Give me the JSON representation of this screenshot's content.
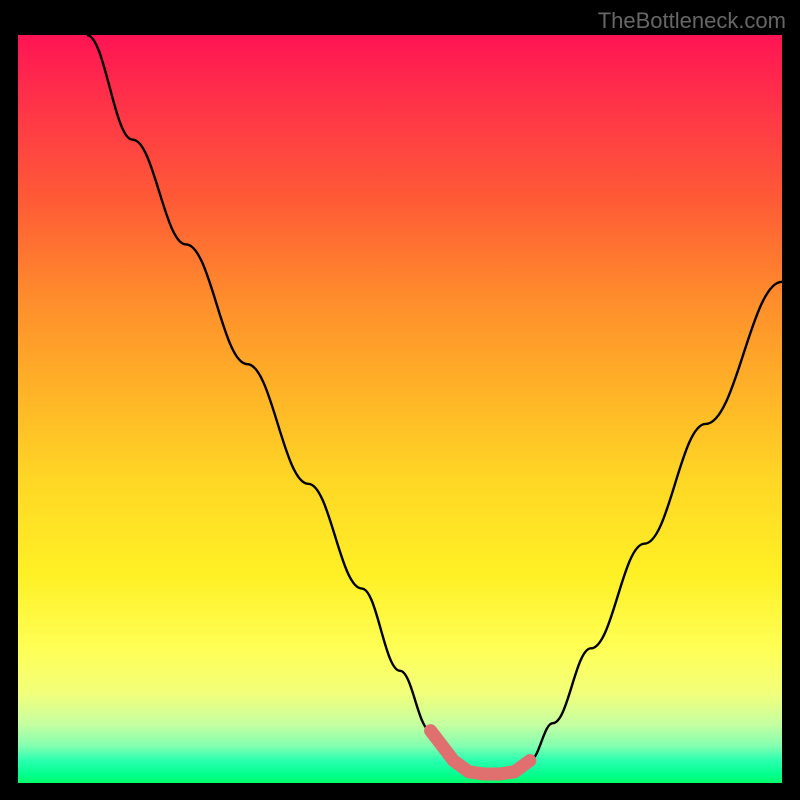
{
  "watermark": "TheBottleneck.com",
  "chart_data": {
    "type": "line",
    "title": "",
    "xlabel": "",
    "ylabel": "",
    "xlim": [
      0,
      100
    ],
    "ylim": [
      0,
      100
    ],
    "series": [
      {
        "name": "curve",
        "x": [
          9,
          15,
          22,
          30,
          38,
          45,
          50,
          54,
          57,
          59,
          61,
          63,
          65,
          67,
          70,
          75,
          82,
          90,
          100
        ],
        "y": [
          100,
          86,
          72,
          56,
          40,
          26,
          15,
          7,
          3,
          1.5,
          1.2,
          1.2,
          1.5,
          3,
          8,
          18,
          32,
          48,
          67
        ]
      }
    ],
    "highlight": {
      "name": "bottom-band",
      "x_range": [
        51,
        67
      ],
      "y_range": [
        0.8,
        4.5
      ],
      "color": "#e07070"
    },
    "gradient_stops": [
      {
        "pos": 0.0,
        "color": "#ff1454"
      },
      {
        "pos": 0.08,
        "color": "#ff2f4a"
      },
      {
        "pos": 0.22,
        "color": "#ff5a36"
      },
      {
        "pos": 0.35,
        "color": "#ff8c2c"
      },
      {
        "pos": 0.48,
        "color": "#ffb427"
      },
      {
        "pos": 0.6,
        "color": "#ffd825"
      },
      {
        "pos": 0.72,
        "color": "#fff025"
      },
      {
        "pos": 0.82,
        "color": "#ffff55"
      },
      {
        "pos": 0.88,
        "color": "#f2ff7a"
      },
      {
        "pos": 0.92,
        "color": "#c8ffa0"
      },
      {
        "pos": 0.95,
        "color": "#85ffb0"
      },
      {
        "pos": 0.97,
        "color": "#2affb0"
      },
      {
        "pos": 0.99,
        "color": "#00ff8a"
      },
      {
        "pos": 1.0,
        "color": "#00ff6a"
      }
    ]
  }
}
